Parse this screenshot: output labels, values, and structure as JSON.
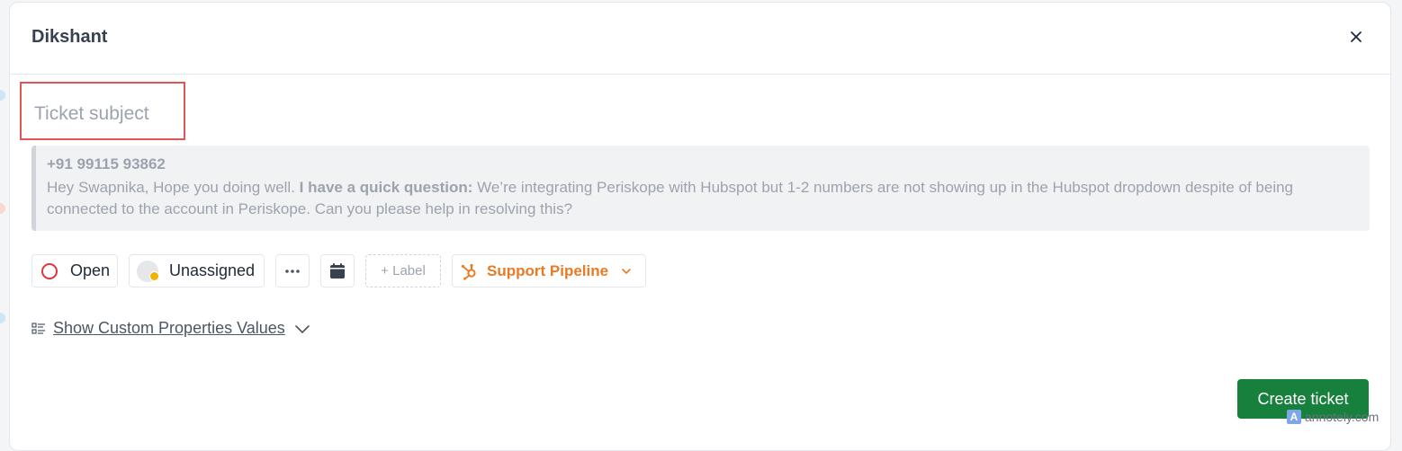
{
  "modal": {
    "title": "Dikshant",
    "subject_placeholder": "Ticket subject"
  },
  "message": {
    "phone": "+91 99115 93862",
    "text_before": "Hey Swapnika, Hope you doing well. ",
    "text_bold": "I have a quick question:",
    "text_after": " We’re integrating Periskope with Hubspot but 1-2 numbers are not showing up in the Hubspot dropdown despite of being connected to the account in Periskope. Can you please help in resolving this?"
  },
  "toolbar": {
    "status": "Open",
    "assignee": "Unassigned",
    "label": "+ Label",
    "pipeline": "Support Pipeline"
  },
  "custom_properties": {
    "label": "Show Custom Properties Values"
  },
  "actions": {
    "create": "Create ticket"
  },
  "watermark": {
    "badge": "A",
    "text": "annotely.com"
  },
  "colors": {
    "primary_button": "#17803d",
    "status_open": "#e0363c",
    "hubspot_orange": "#ea7a23",
    "highlight_box": "#e05555"
  }
}
